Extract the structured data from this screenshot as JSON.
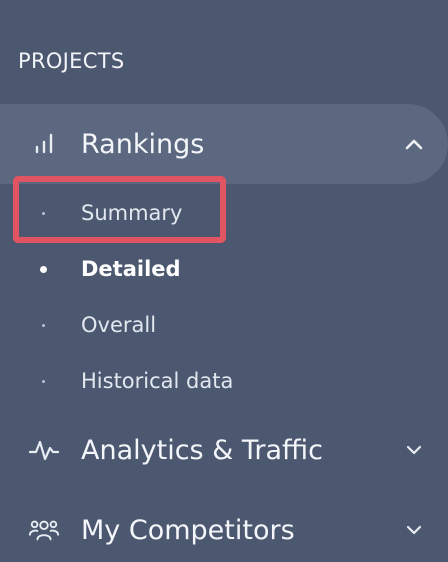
{
  "sidebar": {
    "section_title": "PROJECTS",
    "items": [
      {
        "label": "Rankings",
        "icon": "bar-chart-icon",
        "expanded": true,
        "children": [
          {
            "label": "Summary",
            "highlighted": true
          },
          {
            "label": "Detailed",
            "current": true
          },
          {
            "label": "Overall"
          },
          {
            "label": "Historical data"
          }
        ]
      },
      {
        "label": "Analytics & Traffic",
        "icon": "pulse-icon",
        "expanded": false
      },
      {
        "label": "My Competitors",
        "icon": "users-icon",
        "expanded": false
      }
    ]
  },
  "colors": {
    "background": "#4b5870",
    "active_row": "#5b6880",
    "highlight": "#e05561"
  }
}
